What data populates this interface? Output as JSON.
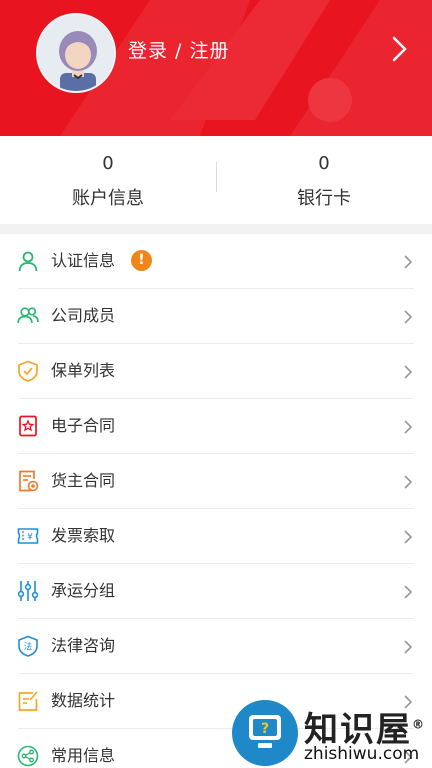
{
  "header": {
    "login_label": "登录 / 注册",
    "brand_color": "#e8141f"
  },
  "stats": [
    {
      "value": "0",
      "label": "账户信息"
    },
    {
      "value": "0",
      "label": "银行卡"
    }
  ],
  "menu": {
    "items": [
      {
        "label": "认证信息",
        "icon": "person-icon",
        "icon_color": "#2bb673",
        "badge": "!"
      },
      {
        "label": "公司成员",
        "icon": "group-icon",
        "icon_color": "#2bb673"
      },
      {
        "label": "保单列表",
        "icon": "shield-check-icon",
        "icon_color": "#f5a623"
      },
      {
        "label": "电子合同",
        "icon": "contract-star-icon",
        "icon_color": "#e8141f"
      },
      {
        "label": "货主合同",
        "icon": "document-seal-icon",
        "icon_color": "#f07a2a"
      },
      {
        "label": "发票索取",
        "icon": "invoice-ticket-icon",
        "icon_color": "#1f8fd6"
      },
      {
        "label": "承运分组",
        "icon": "sliders-icon",
        "icon_color": "#1f8fd6"
      },
      {
        "label": "法律咨询",
        "icon": "law-shield-icon",
        "icon_color": "#1f8fd6"
      },
      {
        "label": "数据统计",
        "icon": "edit-chart-icon",
        "icon_color": "#f5a623"
      },
      {
        "label": "常用信息",
        "icon": "share-icon",
        "icon_color": "#2bb673"
      }
    ]
  },
  "watermark": {
    "title": "知识屋",
    "url": "zhishiwu.com",
    "registered_mark": "®"
  }
}
